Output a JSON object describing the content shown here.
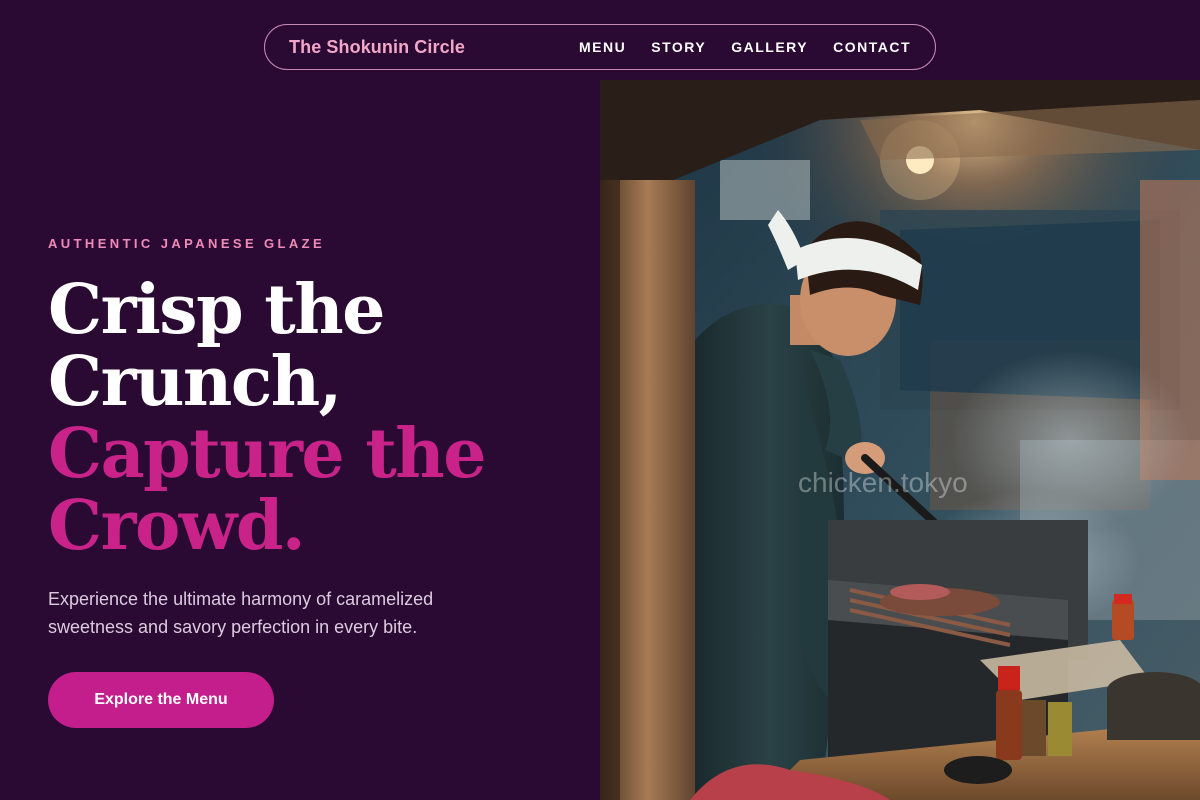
{
  "nav": {
    "brand": "The Shokunin Circle",
    "links": [
      "MENU",
      "STORY",
      "GALLERY",
      "CONTACT"
    ]
  },
  "hero": {
    "eyebrow": "AUTHENTIC JAPANESE GLAZE",
    "headline_white": [
      "Crisp the",
      "Crunch,"
    ],
    "headline_accent": [
      "Capture the",
      "Crowd."
    ],
    "subtitle": "Experience the ultimate harmony of caramelized sweetness and savory perfection in every bite.",
    "cta_label": "Explore the Menu"
  },
  "photo": {
    "watermark": "chicken.tokyo"
  },
  "colors": {
    "background": "#2a0a33",
    "accent": "#c41e8c",
    "accent_text": "#c9238a",
    "brand_text": "#f2a6c8",
    "eyebrow": "#f08ab8"
  }
}
